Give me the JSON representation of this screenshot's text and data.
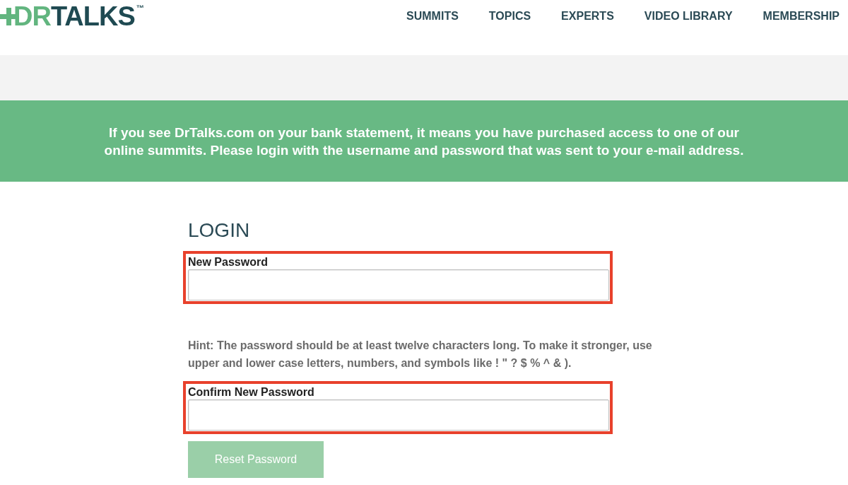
{
  "header": {
    "logo": {
      "accent": "DR",
      "text": "TALKS",
      "trademark": "™"
    },
    "nav": [
      {
        "label": "SUMMITS"
      },
      {
        "label": "TOPICS"
      },
      {
        "label": "EXPERTS"
      },
      {
        "label": "VIDEO LIBRARY"
      },
      {
        "label": "MEMBERSHIP"
      }
    ]
  },
  "notice": {
    "text": "If you see DrTalks.com on your bank statement, it means you have purchased access to one of our online summits. Please login with the username and password that was sent to your e-mail address."
  },
  "form": {
    "title": "LOGIN",
    "items": [
      {
        "kind": "field",
        "label": "New Password",
        "highlighted": true
      },
      {
        "kind": "hint",
        "text": "Hint: The password should be at least twelve characters long. To make it stronger, use upper and lower case letters, numbers, and symbols like ! \" ? $ % ^ & )."
      },
      {
        "kind": "field",
        "label": "Confirm New Password",
        "highlighted": true
      }
    ],
    "submit": {
      "label": "Reset Password",
      "disabled": true
    }
  }
}
